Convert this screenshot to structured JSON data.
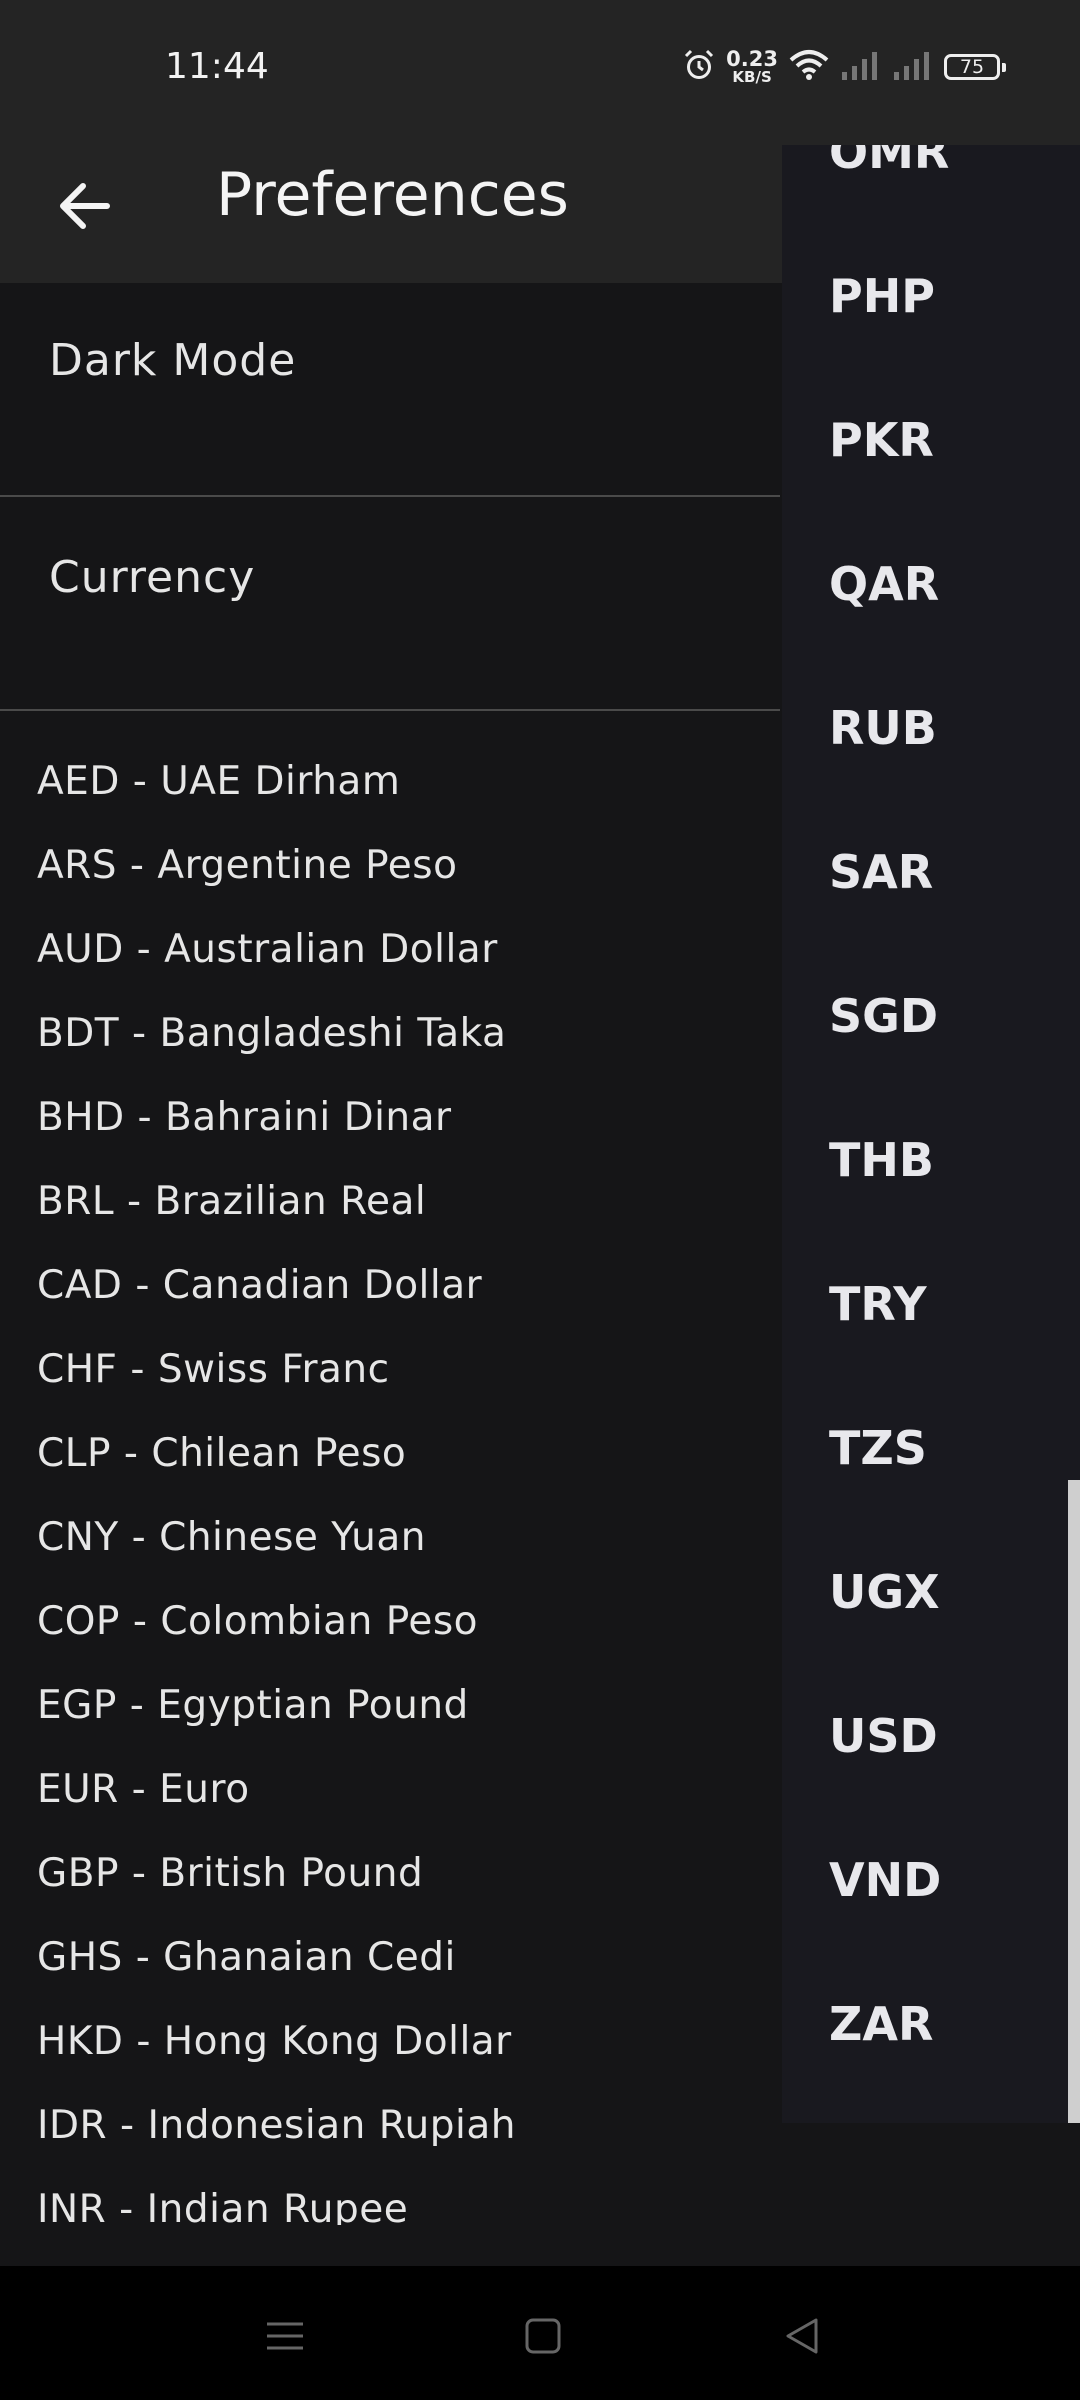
{
  "status_bar": {
    "time": "11:44",
    "net_speed_value": "0.23",
    "net_speed_unit": "KB/S",
    "battery": "75",
    "icons": [
      "alarm-icon",
      "wifi-icon",
      "signal-icon",
      "signal-icon"
    ]
  },
  "app_bar": {
    "title": "Preferences",
    "back_icon": "arrow-left-icon"
  },
  "settings": {
    "dark_mode_label": "Dark Mode",
    "currency_label": "Currency"
  },
  "currency_list": [
    "AED - UAE Dirham",
    "ARS - Argentine Peso",
    "AUD - Australian Dollar",
    "BDT - Bangladeshi Taka",
    "BHD - Bahraini Dinar",
    "BRL - Brazilian Real",
    "CAD - Canadian Dollar",
    "CHF - Swiss Franc",
    "CLP - Chilean Peso",
    "CNY - Chinese Yuan",
    "COP - Colombian Peso",
    "EGP - Egyptian Pound",
    "EUR - Euro",
    "GBP - British Pound",
    "GHS - Ghanaian Cedi",
    "HKD - Hong Kong Dollar",
    "IDR - Indonesian Rupiah",
    "INR - Indian Rupee"
  ],
  "dropdown": {
    "options": [
      "OMR",
      "PHP",
      "PKR",
      "QAR",
      "RUB",
      "SAR",
      "SGD",
      "THB",
      "TRY",
      "TZS",
      "UGX",
      "USD",
      "VND",
      "ZAR"
    ]
  },
  "nav_bar": {
    "icons": [
      "menu-icon",
      "home-icon",
      "back-icon"
    ]
  },
  "colors": {
    "background": "#151517",
    "app_bar": "#242424",
    "dropdown": "#19191f",
    "text": "#e6e6e6"
  }
}
